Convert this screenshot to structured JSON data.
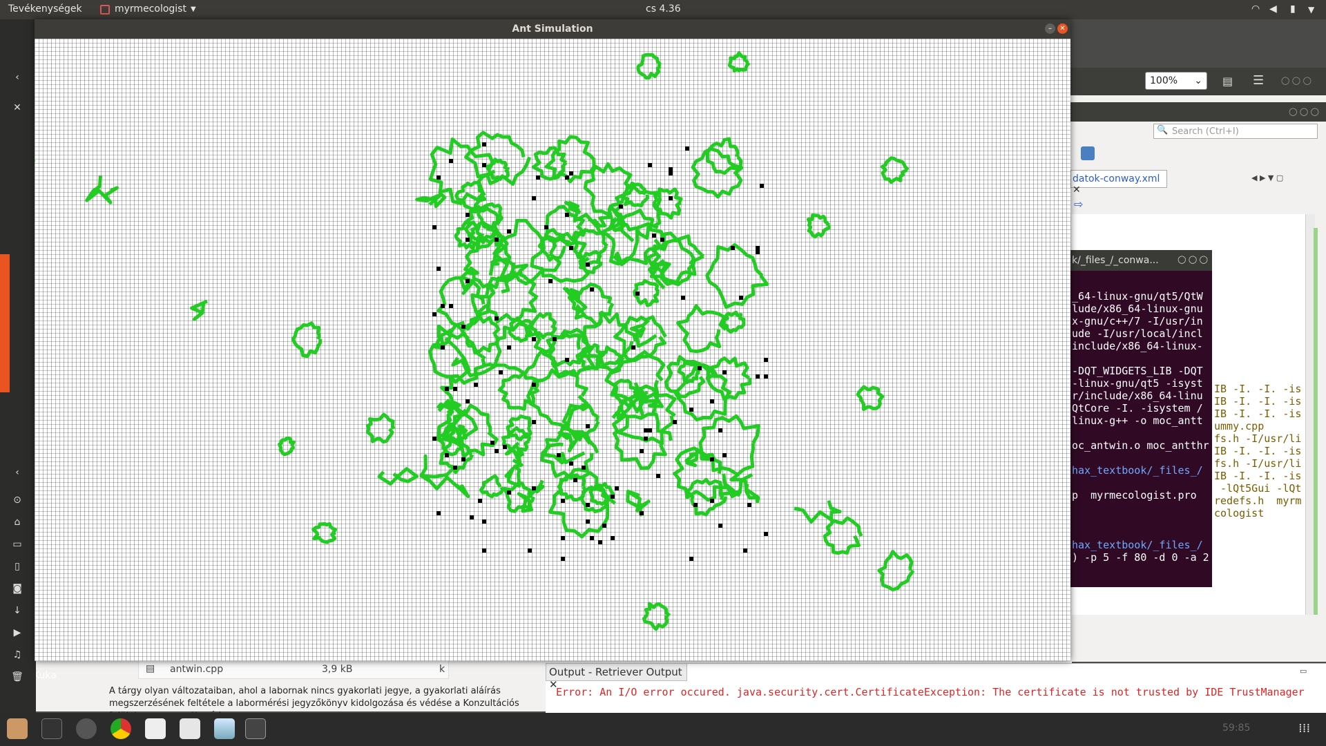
{
  "topbar": {
    "activities": "Tevékenységek",
    "app_menu": "myrmecologist",
    "clock": "cs  4.36"
  },
  "ant_window": {
    "title": "Ant Simulation",
    "grid_color": "#1a1a1a",
    "trail_color": "#22cc22",
    "ant_color": "#000000"
  },
  "bg_viewer": {
    "zoom": "100%"
  },
  "ide": {
    "search_placeholder": "Search (Ctrl+I)",
    "tab_label": "datok-conway.xml",
    "code_lines": [
      "IB -I. -I. -is",
      "IB -I. -I. -is",
      "IB -I. -I. -is",
      "ummy.cpp",
      "fs.h -I/usr/li",
      "IB -I. -I. -is",
      "fs.h -I/usr/li",
      "IB -I. -I. -is",
      " -lQt5Gui -lQt",
      "redefs.h  myrm",
      "cologist"
    ],
    "output_tab": "Output - Retriever Output",
    "output_error": "Error: An I/O error occured. java.security.cert.CertificateException: The certificate is not trusted by IDE TrustManager",
    "status_num": "59:85"
  },
  "terminal": {
    "title": "k/_files_/_conwa...",
    "lines": [
      "_64-linux-gnu/qt5/QtW",
      "lude/x86_64-linux-gnu",
      "x-gnu/c++/7 -I/usr/in",
      "ude -I/usr/local/incl",
      "include/x86_64-linux-",
      "",
      "-DQT_WIDGETS_LIB -DQT",
      "-linux-gnu/qt5 -isyst",
      "r/include/x86_64-linu",
      "QtCore -I. -isystem /",
      "linux-g++ -o moc_antt",
      "",
      "oc_antwin.o moc_antthr",
      "",
      "hax_textbook/_files_/",
      "",
      "p  myrmecologist.pro",
      "",
      "",
      "",
      "hax_textbook/_files_/",
      ") -p 5 -f 80 -d 0 -a 2"
    ]
  },
  "files": {
    "name": "antwin.cpp",
    "size": "3,9 kB",
    "extra": "k"
  },
  "desktop": {
    "trash": "Kuka"
  },
  "course_text": "A tárgy olyan változataiban, ahol a labornak nincs gyakorlati jegye, a gyakorlati aláírás megszerzésének feltétele a labormérési jegyzőkönyv kidolgozása és védése a Konzultációs felületen szervezett módon."
}
